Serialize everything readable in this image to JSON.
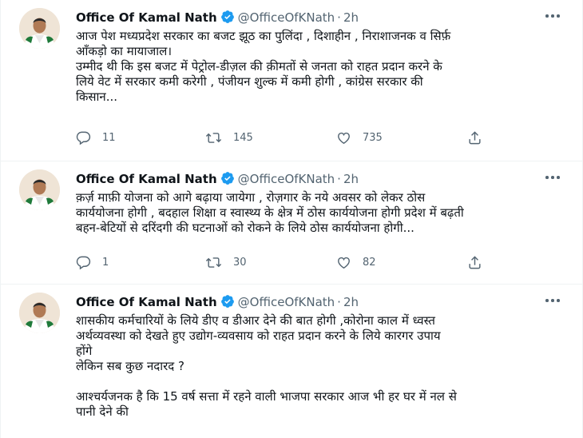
{
  "tweets": [
    {
      "author": "Office Of Kamal Nath",
      "handle": "@OfficeOfKNath",
      "separator": "·",
      "time": "2h",
      "text": "आज पेश मध्यप्रदेश सरकार का बजट झूठ का पुलिंदा , दिशाहीन , निराशाजनक व सिर्फ़\nआँकड़ो का मायाजाल।\nउम्मीद थी कि इस बजट में पेट्रोल-डीज़ल की क़ीमतों से जनता को राहत प्रदान करने के\nलिये वेट में सरकार कमी करेगी , पंजीयन शुल्क में कमी होगी , कांग्रेस सरकार की\nकिसान...",
      "replies": "11",
      "retweets": "145",
      "likes": "735"
    },
    {
      "author": "Office Of Kamal Nath",
      "handle": "@OfficeOfKNath",
      "separator": "·",
      "time": "2h",
      "text": "क़र्ज़ माफ़ी योजना को आगे बढ़ाया जायेगा , रोज़गार के नये अवसर को लेकर ठोस\nकार्ययोजना होगी , बदहाल शिक्षा व स्वास्थ्य के क्षेत्र में ठोस कार्ययोजना होगी प्रदेश में बढ़ती\nबहन-बेटियों से दरिंदगी की घटनाओं को रोकने के लिये ठोस कार्ययोजना होगी...",
      "replies": "1",
      "retweets": "30",
      "likes": "82"
    },
    {
      "author": "Office Of Kamal Nath",
      "handle": "@OfficeOfKNath",
      "separator": "·",
      "time": "2h",
      "text": "शासकीय कर्मचारियों के लिये डीए व डीआर देने की बात होगी ,कोरोना काल में ध्वस्त\nअर्थव्यवस्था को देखते हुए उद्योग-व्यवसाय को राहत प्रदान करने के लिये कारगर उपाय\nहोंगे\nलेकिन सब कुछ नदारद ?\n\nआश्चर्यजनक है कि 15 वर्ष सत्ता में रहने वाली भाजपा सरकार आज भी हर घर में नल से\nपानी देने की"
    }
  ],
  "icons": {
    "verified": "verified-badge-icon",
    "more": "more-options-icon",
    "reply": "reply-icon",
    "retweet": "retweet-icon",
    "like": "like-icon",
    "share": "share-icon"
  },
  "colors": {
    "verified": "#1d9bf0",
    "muted": "#536471",
    "text": "#0f1419",
    "divider": "#eff3f4"
  }
}
